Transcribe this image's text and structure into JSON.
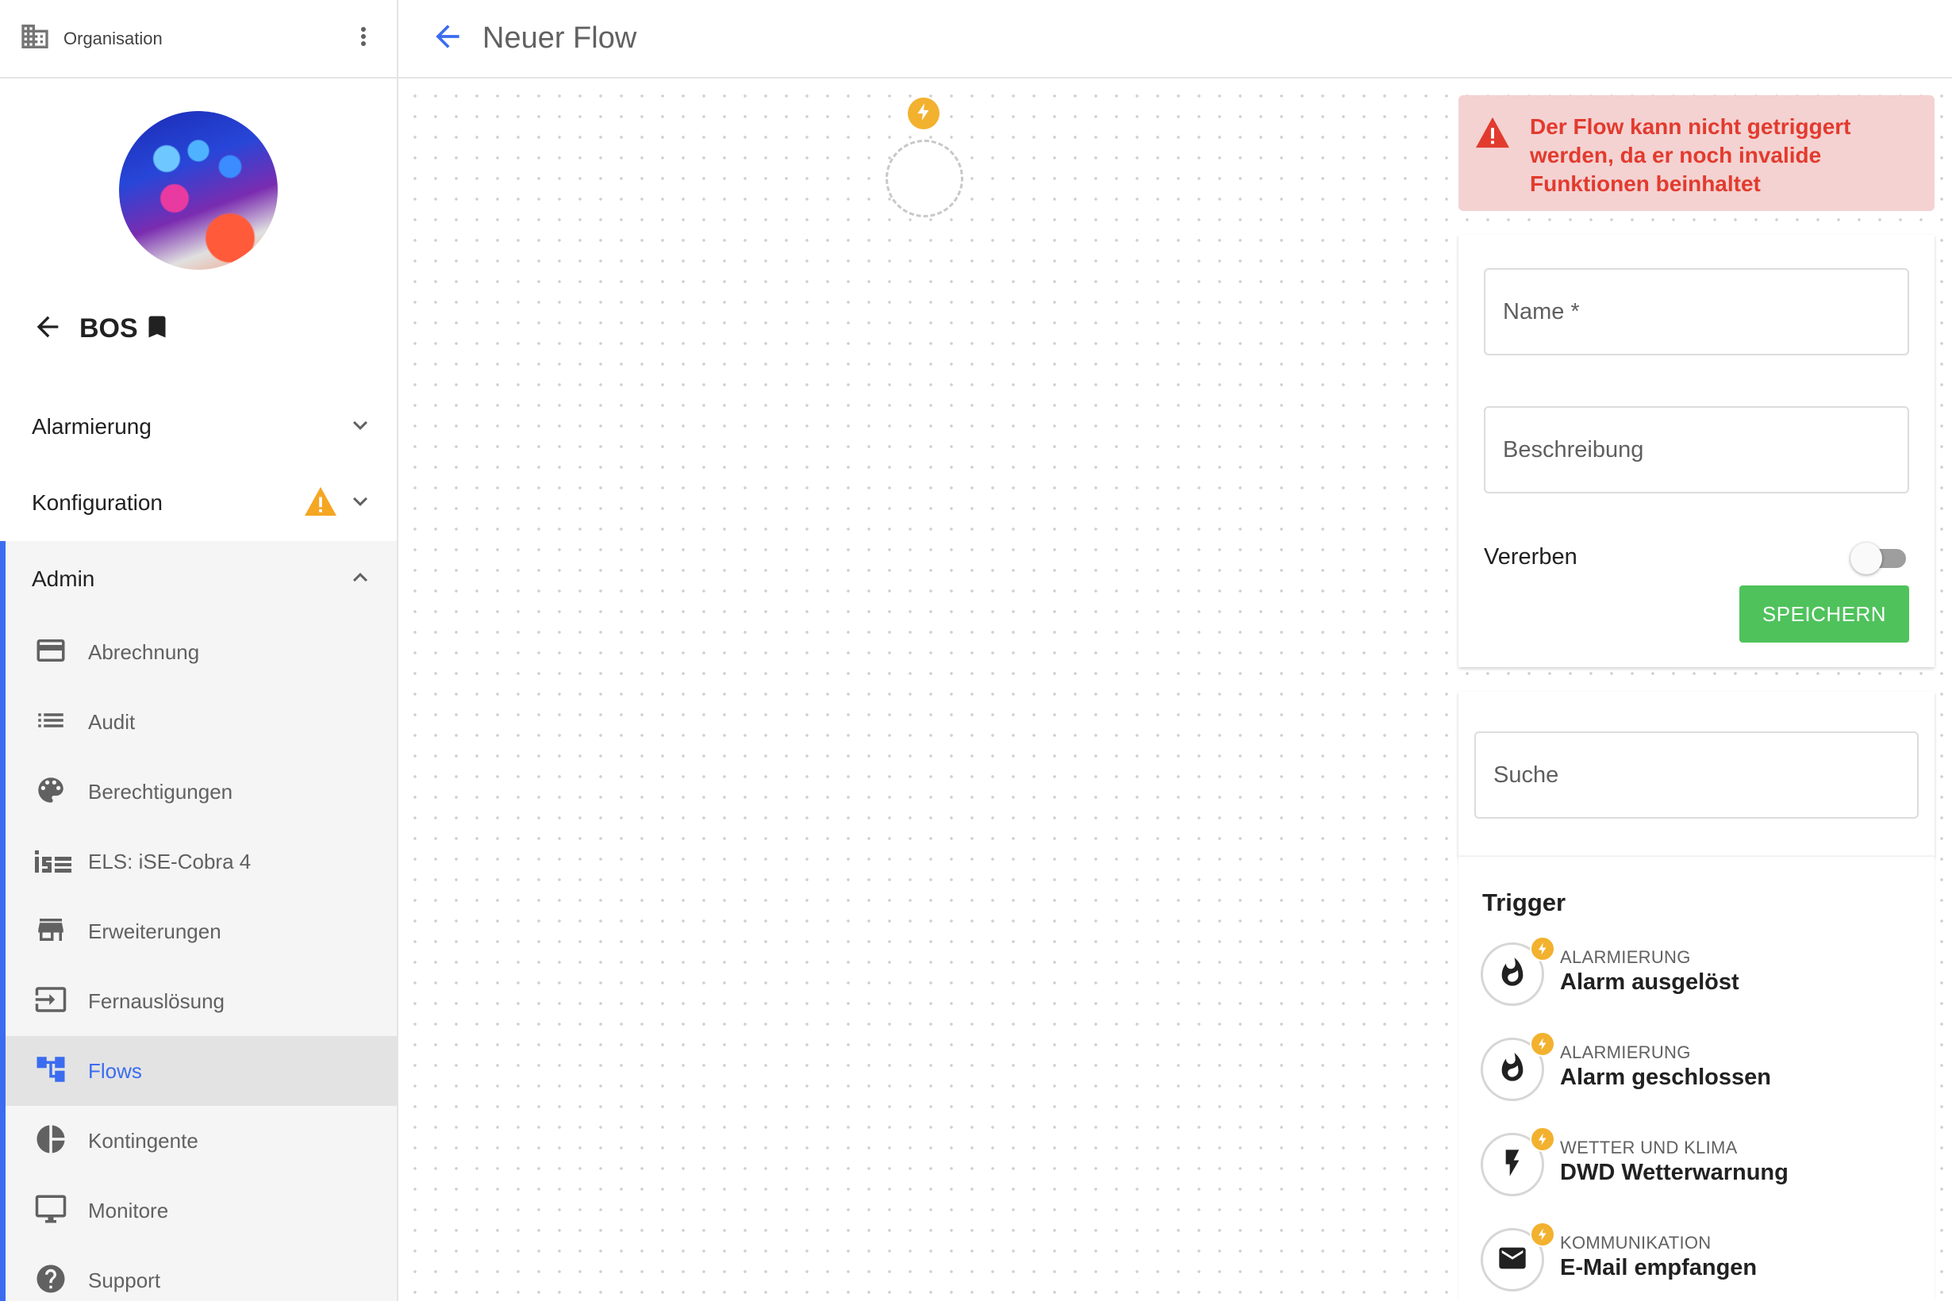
{
  "sidebar": {
    "org_label": "Organisation",
    "account_name": "BOS",
    "sections": {
      "alarmierung": "Alarmierung",
      "konfiguration": "Konfiguration",
      "admin": "Admin"
    },
    "admin_items": [
      {
        "label": "Abrechnung",
        "icon": "credit-card-icon"
      },
      {
        "label": "Audit",
        "icon": "list-icon"
      },
      {
        "label": "Berechtigungen",
        "icon": "palette-icon"
      },
      {
        "label": "ELS: iSE-Cobra 4",
        "icon": "ise-logo-icon"
      },
      {
        "label": "Erweiterungen",
        "icon": "store-icon"
      },
      {
        "label": "Fernauslösung",
        "icon": "input-icon"
      },
      {
        "label": "Flows",
        "icon": "flows-icon",
        "active": true
      },
      {
        "label": "Kontingente",
        "icon": "pie-chart-icon"
      },
      {
        "label": "Monitore",
        "icon": "monitor-icon"
      },
      {
        "label": "Support",
        "icon": "help-icon"
      }
    ]
  },
  "header": {
    "title": "Neuer Flow"
  },
  "alert": {
    "message": "Der Flow kann nicht getriggert werden, da er noch invalide Funktionen beinhaltet"
  },
  "form": {
    "name_placeholder": "Name *",
    "description_placeholder": "Beschreibung",
    "inherit_label": "Vererben",
    "inherit_enabled": false,
    "save_label": "SPEICHERN"
  },
  "search": {
    "placeholder": "Suche"
  },
  "triggers": {
    "title": "Trigger",
    "items": [
      {
        "category": "ALARMIERUNG",
        "name": "Alarm ausgelöst",
        "icon": "flame-icon"
      },
      {
        "category": "ALARMIERUNG",
        "name": "Alarm geschlossen",
        "icon": "flame-icon"
      },
      {
        "category": "WETTER UND KLIMA",
        "name": "DWD Wetterwarnung",
        "icon": "lightning-icon"
      },
      {
        "category": "KOMMUNIKATION",
        "name": "E-Mail empfangen",
        "icon": "mail-icon"
      }
    ]
  },
  "colors": {
    "accent": "#3b6cf0",
    "success": "#4fc25c",
    "warning": "#f5a623",
    "error": "#e23b2e",
    "error_bg": "#f4d2d2",
    "trigger_badge": "#f2b12e"
  }
}
